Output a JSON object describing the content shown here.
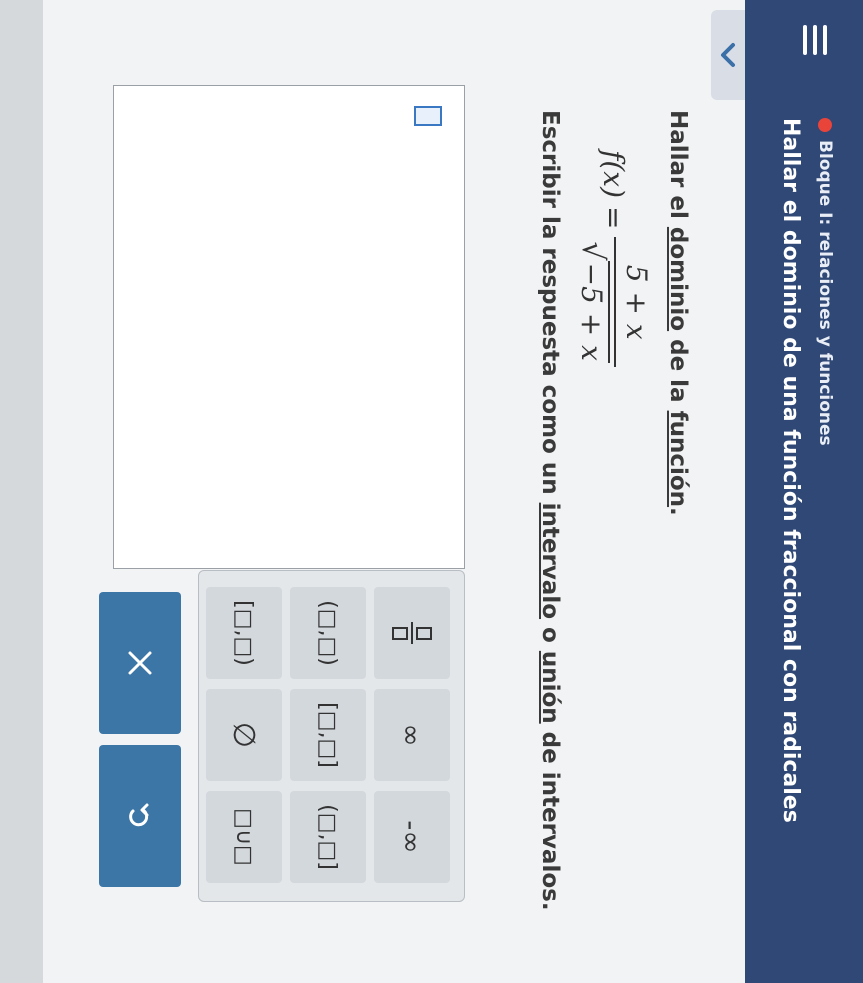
{
  "header": {
    "topic": "Bloque I: relaciones y funciones",
    "subtitle": "Hallar el dominio de una función fraccional con radicales",
    "status_color": "#e8443a",
    "bar_color": "#2f4876"
  },
  "question": {
    "prompt_parts": [
      "Hallar el ",
      "dominio",
      " de la ",
      "función",
      "."
    ],
    "fx": "f(x)",
    "equals": "=",
    "numerator": "5 + x",
    "radicand": "−5 + x",
    "instruction_parts": [
      "Escribir la respuesta como un ",
      "intervalo",
      " o ",
      "unión",
      " de intervalos."
    ]
  },
  "keypad": {
    "keys": [
      "fraction",
      "∞",
      "-∞",
      "(□,□)",
      "[□,□]",
      "(□,□]",
      "[□,□)",
      "∅",
      "□∪□"
    ]
  },
  "actions": {
    "clear_icon": "x-icon",
    "undo_icon": "undo-icon",
    "color": "#3c76a6"
  }
}
